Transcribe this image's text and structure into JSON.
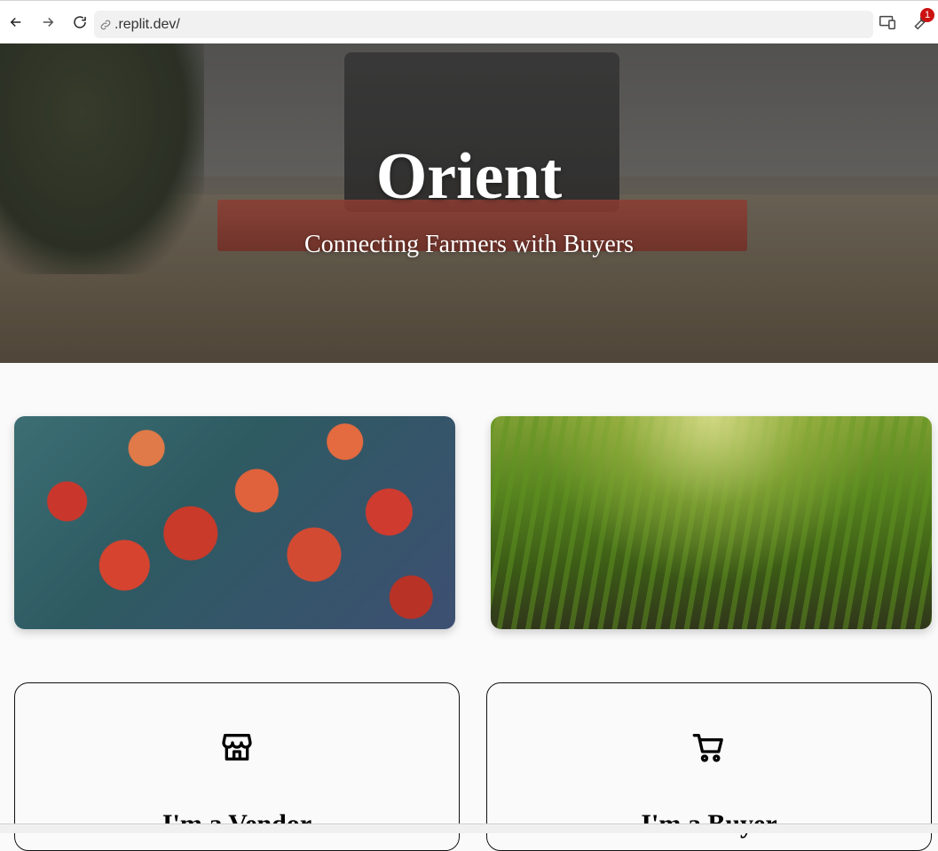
{
  "browser": {
    "url": ".replit.dev/",
    "notification_count": "1"
  },
  "hero": {
    "title": "Orient",
    "subtitle": "Connecting Farmers with Buyers"
  },
  "photos": [
    {
      "name": "tomatoes"
    },
    {
      "name": "corn-field"
    }
  ],
  "roles": {
    "vendor": {
      "title": "I'm a Vendor",
      "icon": "store-icon"
    },
    "buyer": {
      "title": "I'm a Buyer",
      "icon": "cart-icon"
    }
  }
}
